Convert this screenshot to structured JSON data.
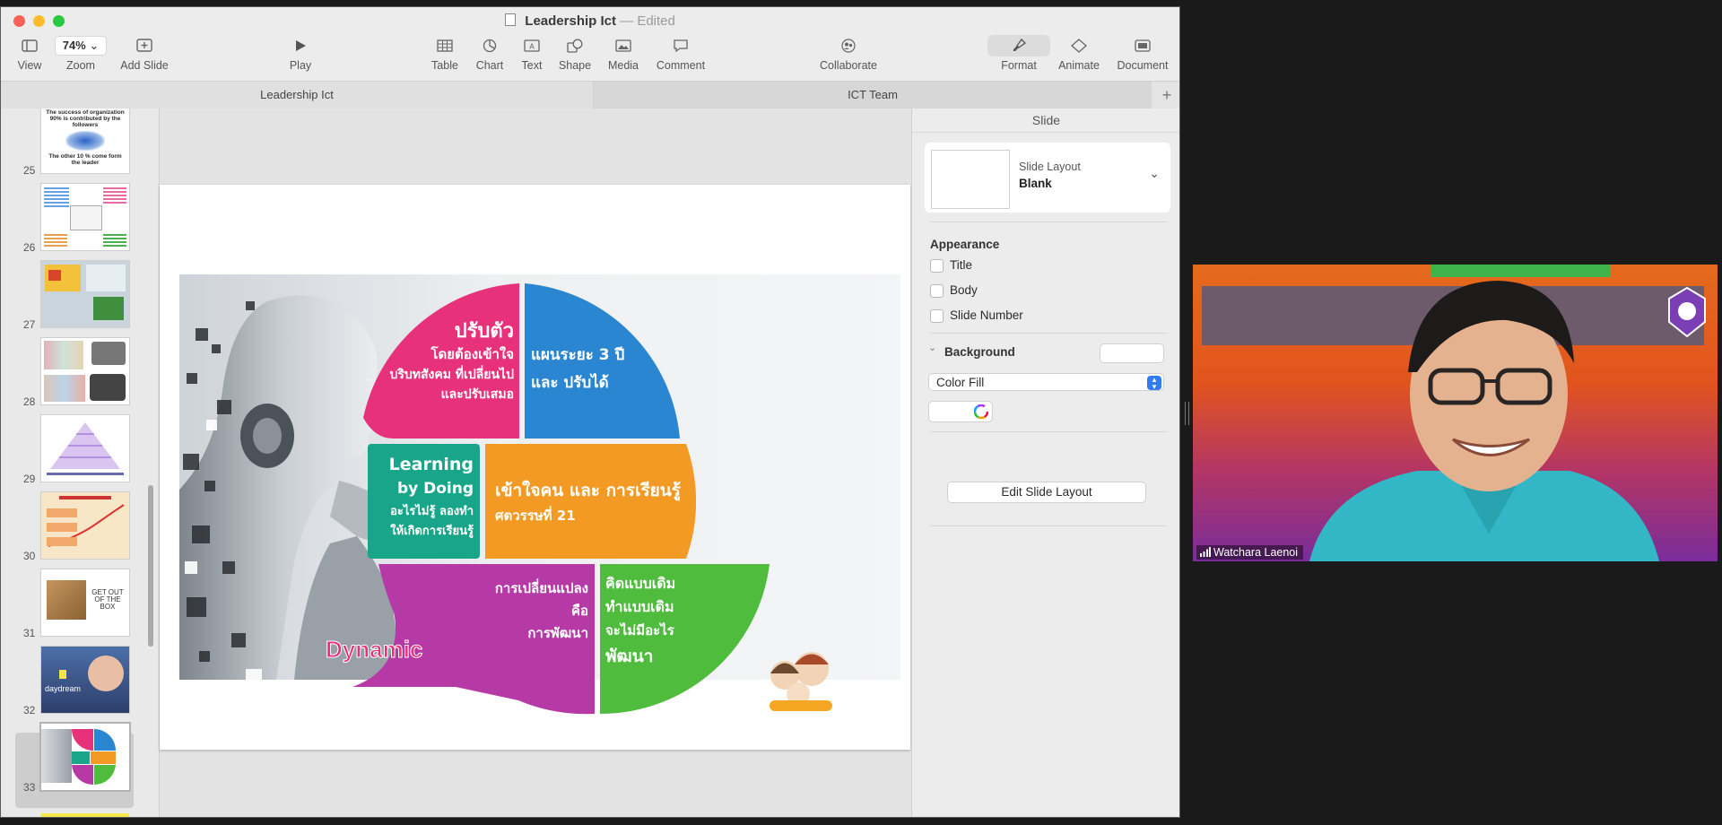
{
  "window": {
    "title": "Leadership Ict",
    "status": "Edited",
    "separator": "—"
  },
  "toolbar": {
    "view": "View",
    "zoom_value": "74%",
    "zoom": "Zoom",
    "add_slide": "Add Slide",
    "play": "Play",
    "table": "Table",
    "chart": "Chart",
    "text": "Text",
    "shape": "Shape",
    "media": "Media",
    "comment": "Comment",
    "collaborate": "Collaborate",
    "format": "Format",
    "animate": "Animate",
    "document": "Document"
  },
  "tabs": [
    {
      "label": "Leadership Ict"
    },
    {
      "label": "ICT Team"
    }
  ],
  "navigator": {
    "slides": [
      {
        "number": "25",
        "title_text": "The success of organization 90% is contributed by the followers",
        "caption": "The other 10 % come form the leader"
      },
      {
        "number": "26"
      },
      {
        "number": "27"
      },
      {
        "number": "28"
      },
      {
        "number": "29"
      },
      {
        "number": "30"
      },
      {
        "number": "31",
        "caption": "GET OUT OF THE BOX"
      },
      {
        "number": "32",
        "caption": "daydream"
      },
      {
        "number": "33",
        "selected": true
      }
    ]
  },
  "slide": {
    "segments": {
      "pink": [
        "ปรับตัว",
        "โดยต้องเข้าใจ",
        "บริบทสังคม ที่เปลี่ยนไป",
        "และปรับเสมอ"
      ],
      "blue": [
        "แผนระยะ 3 ปี",
        "และ ปรับได้"
      ],
      "teal": [
        "Learning",
        "by Doing",
        "อะไรไม่รู้ ลองทำ",
        "ให้เกิดการเรียนรู้"
      ],
      "orange": [
        "เข้าใจคน และ การเรียนรู้",
        "ศตวรรษที่ 21"
      ],
      "purple": [
        "การเปลี่ยนแปลง",
        "คือ",
        "การพัฒนา"
      ],
      "green": [
        "คิดแบบเดิม",
        "ทำแบบเดิม",
        "จะไม่มีอะไร",
        "พัฒนา"
      ]
    },
    "dynamic_word": "Dynamic",
    "colors": {
      "pink": "#e8317b",
      "blue": "#2a86d1",
      "teal": "#19a58a",
      "orange": "#f39a24",
      "purple": "#b53aa6",
      "green": "#4fbc3e"
    }
  },
  "inspector": {
    "title": "Slide",
    "layout_label": "Slide Layout",
    "layout_value": "Blank",
    "appearance": "Appearance",
    "title_option": "Title",
    "body_option": "Body",
    "slide_number_option": "Slide Number",
    "background": "Background",
    "fill_type": "Color Fill",
    "edit_layout": "Edit Slide Layout"
  },
  "video": {
    "participant": "Watchara Laenoi"
  }
}
